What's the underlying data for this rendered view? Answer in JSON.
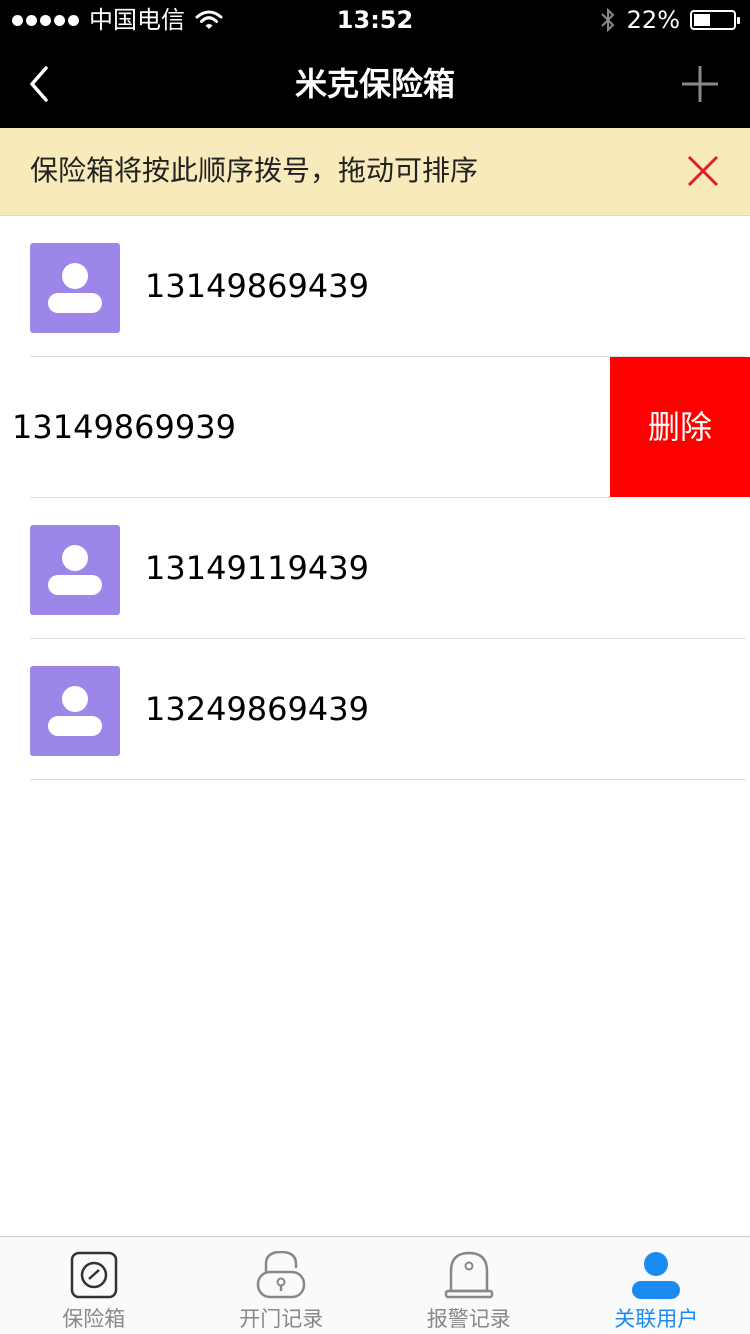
{
  "status_bar": {
    "carrier": "中国电信",
    "time": "13:52",
    "battery_percent": "22%",
    "battery_level": 0.22,
    "icons": [
      "signal-icon",
      "wifi-icon",
      "bluetooth-icon",
      "battery-icon"
    ]
  },
  "nav": {
    "title": "米克保险箱",
    "back_icon": "chevron-left-icon",
    "add_icon": "plus-icon"
  },
  "notice": {
    "text": "保险箱将按此顺序拨号，拖动可排序",
    "close_icon": "close-icon"
  },
  "contacts": [
    {
      "phone": "13149869439"
    },
    {
      "phone": "13149869939",
      "delete_label": "删除"
    },
    {
      "phone": "13149119439"
    },
    {
      "phone": "13249869439"
    }
  ],
  "tabs": [
    {
      "label": "保险箱",
      "icon": "safe-dial-icon"
    },
    {
      "label": "开门记录",
      "icon": "unlock-icon"
    },
    {
      "label": "报警记录",
      "icon": "alarm-bell-icon"
    },
    {
      "label": "关联用户",
      "icon": "user-icon",
      "active": true
    }
  ],
  "colors": {
    "nav_bg": "#000000",
    "notice_bg": "#f8eabb",
    "avatar": "#9d86e9",
    "delete": "#ff0000",
    "active_tab": "#1a8cf0",
    "close_icon": "#e02020"
  }
}
